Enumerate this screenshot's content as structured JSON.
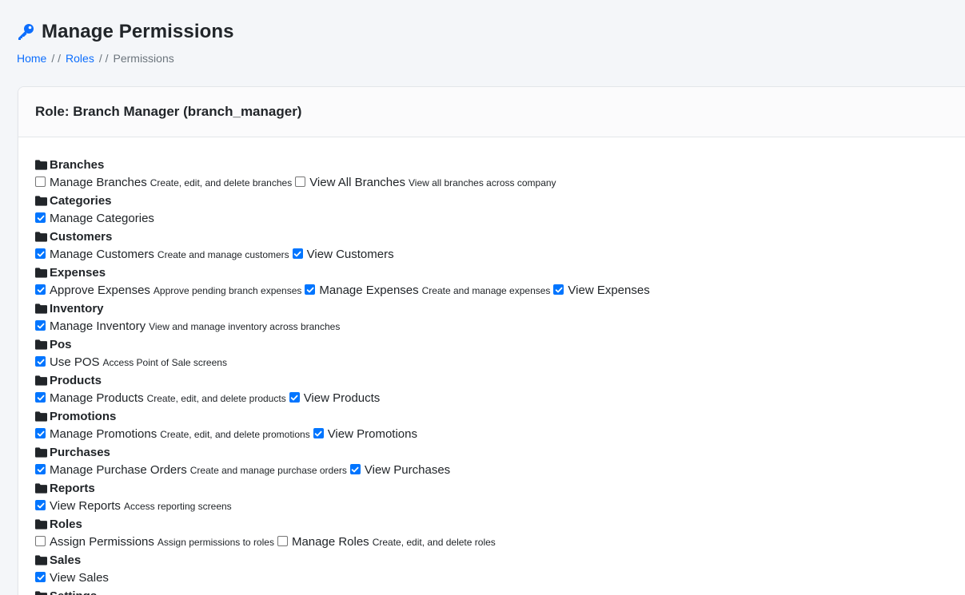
{
  "header": {
    "title": "Manage Permissions",
    "icon": "key-icon",
    "accent": "#0d6efd"
  },
  "breadcrumb": {
    "home": "Home",
    "roles": "Roles",
    "current": "Permissions",
    "separator": "/ /"
  },
  "card": {
    "title": "Role: Branch Manager (branch_manager)"
  },
  "groups": [
    {
      "name": "Branches",
      "perms": [
        {
          "label": "Manage Branches",
          "desc": "Create, edit, and delete branches",
          "checked": false
        },
        {
          "label": "View All Branches",
          "desc": "View all branches across company",
          "checked": false
        }
      ]
    },
    {
      "name": "Categories",
      "perms": [
        {
          "label": "Manage Categories",
          "desc": "",
          "checked": true
        }
      ]
    },
    {
      "name": "Customers",
      "perms": [
        {
          "label": "Manage Customers",
          "desc": "Create and manage customers",
          "checked": true
        },
        {
          "label": "View Customers",
          "desc": "",
          "checked": true
        }
      ]
    },
    {
      "name": "Expenses",
      "perms": [
        {
          "label": "Approve Expenses",
          "desc": "Approve pending branch expenses",
          "checked": true
        },
        {
          "label": "Manage Expenses",
          "desc": "Create and manage expenses",
          "checked": true
        },
        {
          "label": "View Expenses",
          "desc": "",
          "checked": true
        }
      ]
    },
    {
      "name": "Inventory",
      "perms": [
        {
          "label": "Manage Inventory",
          "desc": "View and manage inventory across branches",
          "checked": true
        }
      ]
    },
    {
      "name": "Pos",
      "perms": [
        {
          "label": "Use POS",
          "desc": "Access Point of Sale screens",
          "checked": true
        }
      ]
    },
    {
      "name": "Products",
      "perms": [
        {
          "label": "Manage Products",
          "desc": "Create, edit, and delete products",
          "checked": true
        },
        {
          "label": "View Products",
          "desc": "",
          "checked": true
        }
      ]
    },
    {
      "name": "Promotions",
      "perms": [
        {
          "label": "Manage Promotions",
          "desc": "Create, edit, and delete promotions",
          "checked": true
        },
        {
          "label": "View Promotions",
          "desc": "",
          "checked": true
        }
      ]
    },
    {
      "name": "Purchases",
      "perms": [
        {
          "label": "Manage Purchase Orders",
          "desc": "Create and manage purchase orders",
          "checked": true
        },
        {
          "label": "View Purchases",
          "desc": "",
          "checked": true
        }
      ]
    },
    {
      "name": "Reports",
      "perms": [
        {
          "label": "View Reports",
          "desc": "Access reporting screens",
          "checked": true
        }
      ]
    },
    {
      "name": "Roles",
      "perms": [
        {
          "label": "Assign Permissions",
          "desc": "Assign permissions to roles",
          "checked": false
        },
        {
          "label": "Manage Roles",
          "desc": "Create, edit, and delete roles",
          "checked": false
        }
      ]
    },
    {
      "name": "Sales",
      "perms": [
        {
          "label": "View Sales",
          "desc": "",
          "checked": true
        }
      ]
    },
    {
      "name": "Settings",
      "perms": []
    }
  ]
}
